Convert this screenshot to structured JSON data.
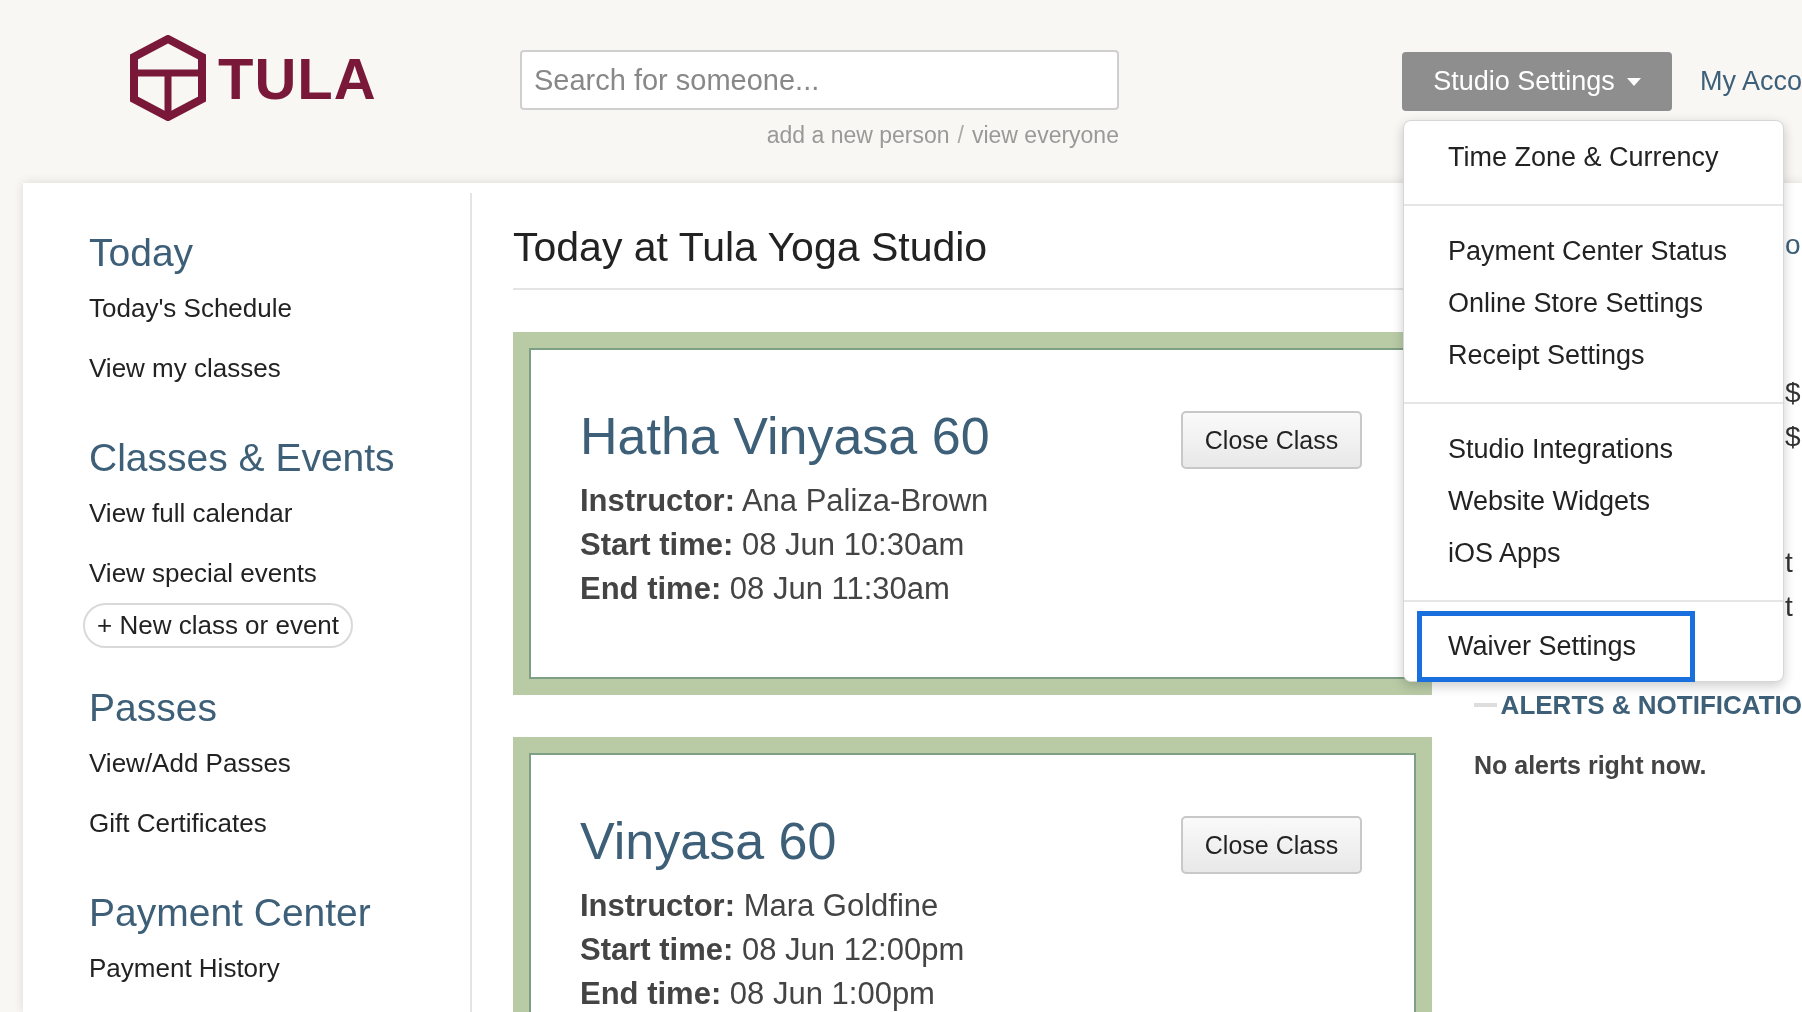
{
  "logo": {
    "text": "TULA"
  },
  "search": {
    "placeholder": "Search for someone...",
    "links": [
      "add a new person",
      "view everyone"
    ],
    "separator": "/"
  },
  "nav": {
    "studio_settings": {
      "label": "Studio Settings",
      "expanded": true
    },
    "my_account": "My Acco"
  },
  "dropdown": {
    "groups": [
      {
        "items": [
          {
            "label": "Time Zone & Currency",
            "selected": false
          }
        ]
      },
      {
        "items": [
          {
            "label": "Payment Center Status",
            "selected": false
          },
          {
            "label": "Online Store Settings",
            "selected": false
          },
          {
            "label": "Receipt Settings",
            "selected": false
          }
        ]
      },
      {
        "items": [
          {
            "label": "Studio Integrations",
            "selected": false
          },
          {
            "label": "Website Widgets",
            "selected": false
          },
          {
            "label": "iOS Apps",
            "selected": false
          }
        ]
      },
      {
        "items": [
          {
            "label": "Waiver Settings",
            "selected": true
          }
        ]
      }
    ]
  },
  "sidebar": {
    "sections": [
      {
        "heading": "Today",
        "items": [
          {
            "kind": "link",
            "label": "Today's Schedule"
          },
          {
            "kind": "link",
            "label": "View my classes"
          }
        ]
      },
      {
        "heading": "Classes & Events",
        "items": [
          {
            "kind": "link",
            "label": "View full calendar"
          },
          {
            "kind": "link",
            "label": "View special events"
          },
          {
            "kind": "button",
            "label": "+ New class or event"
          }
        ]
      },
      {
        "heading": "Passes",
        "items": [
          {
            "kind": "link",
            "label": "View/Add Passes"
          },
          {
            "kind": "link",
            "label": "Gift Certificates"
          }
        ]
      },
      {
        "heading": "Payment Center",
        "items": [
          {
            "kind": "link",
            "label": "Payment History"
          }
        ]
      }
    ]
  },
  "main": {
    "title": "Today at Tula Yoga Studio",
    "classes": [
      {
        "name": "Hatha Vinyasa 60",
        "button": "Close Class",
        "details": [
          {
            "label": "Instructor:",
            "value": "Ana Paliza-Brown"
          },
          {
            "label": "Start time:",
            "value": "08 Jun 10:30am"
          },
          {
            "label": "End time:",
            "value": "08 Jun 11:30am"
          }
        ]
      },
      {
        "name": "Vinyasa 60",
        "button": "Close Class",
        "details": [
          {
            "label": "Instructor:",
            "value": "Mara Goldfine"
          },
          {
            "label": "Start time:",
            "value": "08 Jun 12:00pm"
          },
          {
            "label": "End time:",
            "value": "08 Jun 1:00pm"
          }
        ]
      }
    ]
  },
  "right_panel": {
    "partly_hidden_texts": [
      [
        "o"
      ],
      [
        "$",
        "$"
      ],
      [
        "t",
        "t"
      ]
    ],
    "alerts": {
      "heading": "ALERTS & NOTIFICATIO",
      "message": "No alerts right now."
    }
  }
}
